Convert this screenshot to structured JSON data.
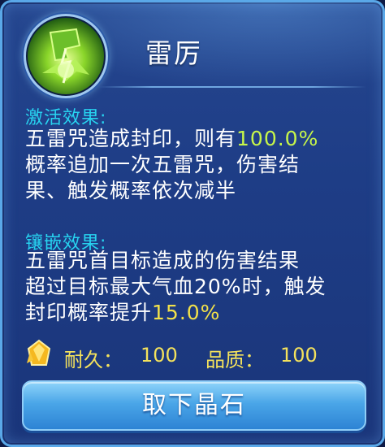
{
  "item": {
    "title": "雷厉",
    "icon": "green-lightning-rune-icon"
  },
  "activation": {
    "heading": "激活效果:",
    "line1_prefix": "五雷咒造成封印，则有",
    "line1_value": "100.0%",
    "line2": "概率追加一次五雷咒，伤害结",
    "line3": "果、触发概率依次减半"
  },
  "inlay": {
    "heading": "镶嵌效果:",
    "line1": "五雷咒首目标造成的伤害结果",
    "line2": "超过目标最大气血20%时，触发",
    "line3_prefix": "封印概率提升",
    "line3_value": "15.0%"
  },
  "stats": {
    "durability_label": "耐久：",
    "durability_value": "100",
    "quality_label": "品质：",
    "quality_value": "100",
    "gem_icon": "yellow-crystal-icon"
  },
  "actions": {
    "remove_label": "取下晶石"
  },
  "colors": {
    "heading": "#27d3f0",
    "highlight_green": "#c6f54a",
    "highlight_yellow": "#f2e14a",
    "stat_text": "#f4e25c",
    "button": "#4aa6e8"
  }
}
